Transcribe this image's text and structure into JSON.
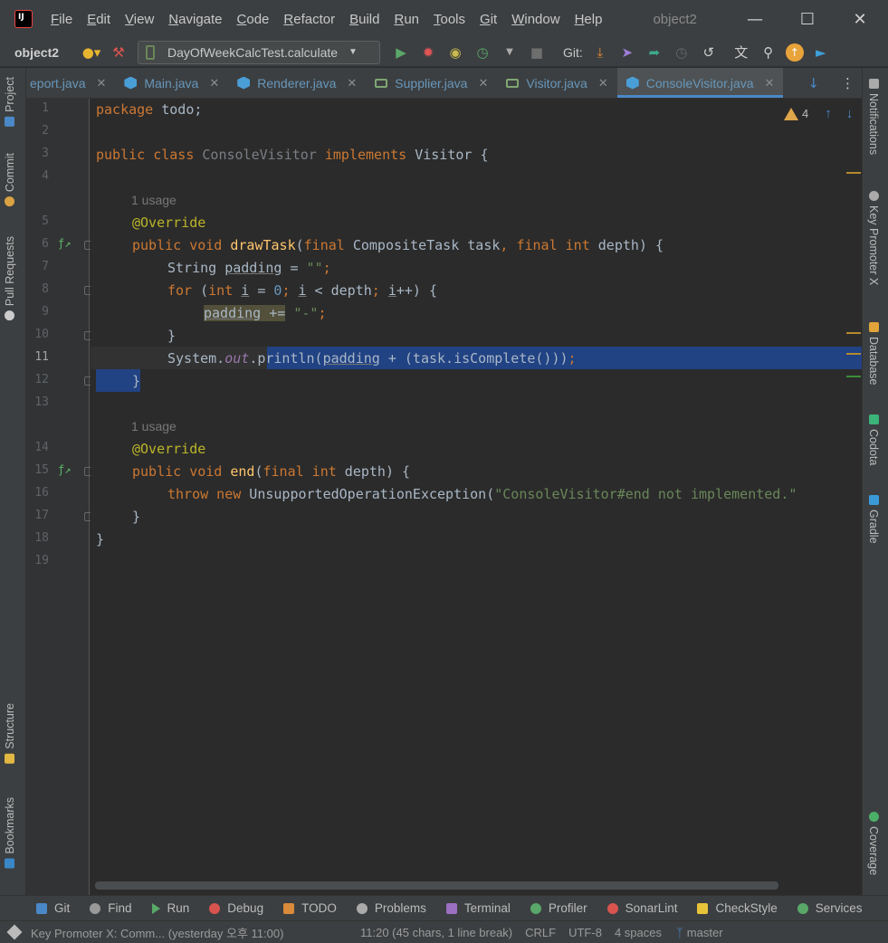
{
  "window": {
    "title": "object2",
    "menu": [
      "File",
      "Edit",
      "View",
      "Navigate",
      "Code",
      "Refactor",
      "Build",
      "Run",
      "Tools",
      "Git",
      "Window",
      "Help"
    ],
    "min_glyph": "—",
    "max_glyph": "☐",
    "close_glyph": "✕"
  },
  "toolbar": {
    "project": "object2",
    "run_config": "DayOfWeekCalcTest.calculate",
    "git_label": "Git:"
  },
  "tabs": [
    {
      "label": "eport.java",
      "icon": "none",
      "active": false
    },
    {
      "label": "Main.java",
      "icon": "class",
      "active": false
    },
    {
      "label": "Renderer.java",
      "icon": "class",
      "active": false
    },
    {
      "label": "Supplier.java",
      "icon": "interface",
      "active": false
    },
    {
      "label": "Visitor.java",
      "icon": "interface",
      "active": false
    },
    {
      "label": "ConsoleVisitor.java",
      "icon": "class",
      "active": true
    }
  ],
  "left_tools": {
    "project": "Project",
    "commit": "Commit",
    "pull_requests": "Pull Requests",
    "structure": "Structure",
    "bookmarks": "Bookmarks"
  },
  "right_tools": {
    "notifications": "Notifications",
    "key_promoter": "Key Promoter X",
    "database": "Database",
    "codota": "Codota",
    "gradle": "Gradle",
    "coverage": "Coverage"
  },
  "editor": {
    "line_numbers": [
      "1",
      "2",
      "3",
      "4",
      "5",
      "6",
      "7",
      "8",
      "9",
      "10",
      "11",
      "12",
      "13",
      "14",
      "15",
      "16",
      "17",
      "18",
      "19"
    ],
    "usage_hint": "1 usage",
    "warnings_count": "4",
    "code": {
      "l1_kw": "package",
      "l1_rest": " todo;",
      "l3_kw1": "public class",
      "l3_name": " ConsoleVisitor ",
      "l3_kw2": "implements",
      "l3_rest": " Visitor {",
      "l5_ann": "@Override",
      "l6_kw": "public void",
      "l6_fn": " drawTask",
      "l6_p1": "(",
      "l6_kw2": "final",
      "l6_p2": " CompositeTask task",
      "l6_p3": ", ",
      "l6_kw3": "final int",
      "l6_p4": " depth) {",
      "l7_type": "String ",
      "l7_var": "padding",
      "l7_eq": " = ",
      "l7_str": "\"\"",
      "l7_semi": ";",
      "l8_kw": "for",
      "l8_p1": " (",
      "l8_kw2": "int",
      "l8_sp": " ",
      "l8_i": "i",
      "l8_eq": " = ",
      "l8_num": "0",
      "l8_semi": "; ",
      "l8_i2": "i",
      "l8_lt": " < depth",
      "l8_semi2": "; ",
      "l8_i3": "i",
      "l8_end": "++) {",
      "l9_var": "padding",
      "l9_op": " +=",
      "l9_sp": " ",
      "l9_str": "\"-\"",
      "l9_semi": ";",
      "l10": "}",
      "l11_a": "System.",
      "l11_fld": "out",
      "l11_b": ".println(",
      "l11_var": "padding",
      "l11_c": " + (task.isComplete()))",
      "l11_semi": ";",
      "l12": "}",
      "l14_ann": "@Override",
      "l15_kw": "public void",
      "l15_fn": " end",
      "l15_p1": "(",
      "l15_kw2": "final int",
      "l15_p2": " depth) {",
      "l16_kw": "throw new",
      "l16_cls": " UnsupportedOperationException(",
      "l16_str": "\"ConsoleVisitor#end not implemented.\"",
      "l17": "}",
      "l18": "}"
    }
  },
  "bottom_tools": [
    "Git",
    "Find",
    "Run",
    "Debug",
    "TODO",
    "Problems",
    "Terminal",
    "Profiler",
    "SonarLint",
    "CheckStyle",
    "Services"
  ],
  "status": {
    "message": "Key Promoter X: Comm... (yesterday 오후 11:00)",
    "position": "11:20 (45 chars, 1 line break)",
    "line_sep": "CRLF",
    "encoding": "UTF-8",
    "indent": "4 spaces",
    "branch": "master"
  },
  "colors": {
    "accent": "#4a88c7",
    "selection": "#214283",
    "keyword": "#cc7832",
    "string": "#6a8759",
    "function": "#ffc66d",
    "annotation": "#bbb529"
  }
}
